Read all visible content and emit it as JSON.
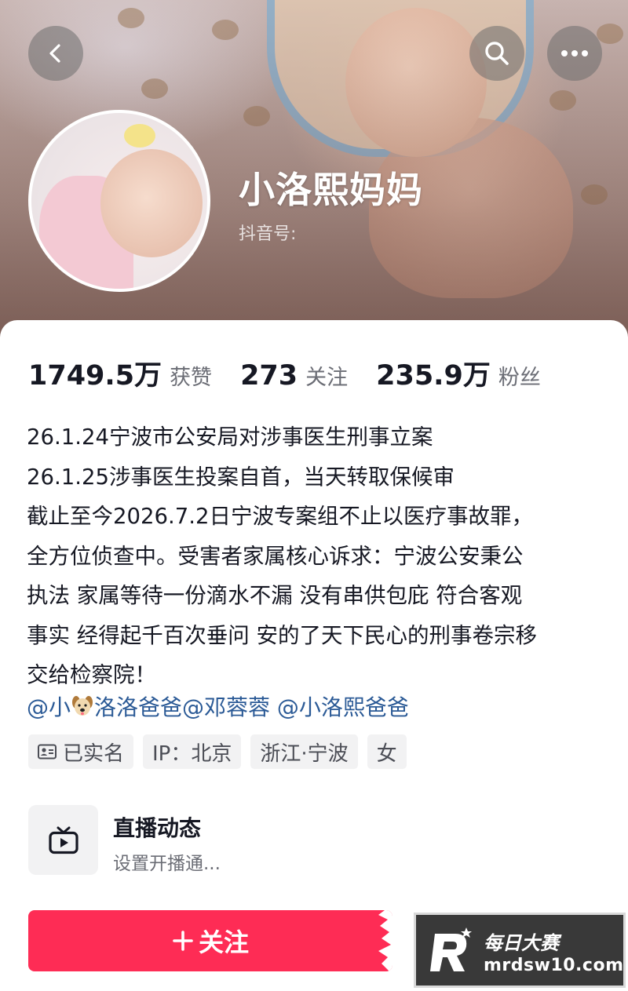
{
  "header": {
    "back_icon": "chevron-left-icon",
    "search_icon": "search-icon",
    "more_icon": "more-dots-icon"
  },
  "profile": {
    "name": "小洛熙妈妈",
    "douyin_id_label": "抖音号:"
  },
  "stats": [
    {
      "value": "1749.5万",
      "label": "获赞"
    },
    {
      "value": "273",
      "label": "关注"
    },
    {
      "value": "235.9万",
      "label": "粉丝"
    }
  ],
  "bio": [
    "26.1.24宁波市公安局对涉事医生刑事立案",
    "26.1.25涉事医生投案自首，当天转取保候审",
    "截止至今2026.7.2日宁波专案组不止以医疗事故罪，",
    "全方位侦查中。受害者家属核心诉求：宁波公安秉公",
    "执法 家属等待一份滴水不漏 没有串供包庇 符合客观",
    "事实 经得起千百次垂问 安的了天下民心的刑事卷宗移",
    "交给检察院！"
  ],
  "mentions": {
    "part1": "@小",
    "part2": "洛洛爸爸@邓蓉蓉 @小洛熙爸爸",
    "emoji_icon": "dog-face-icon"
  },
  "tags": [
    {
      "label": "已实名",
      "icon": "id-card-icon"
    },
    {
      "label": "IP：北京"
    },
    {
      "label": "浙江·宁波"
    },
    {
      "label": "女"
    }
  ],
  "live": {
    "icon": "tv-icon",
    "title": "直播动态",
    "subtitle": "设置开播通..."
  },
  "follow_button": {
    "label": "关注",
    "icon": "plus-icon",
    "color": "#fe2c55"
  },
  "watermark": {
    "brand_cn": "每日大赛",
    "url": "mrdsw10.com"
  }
}
